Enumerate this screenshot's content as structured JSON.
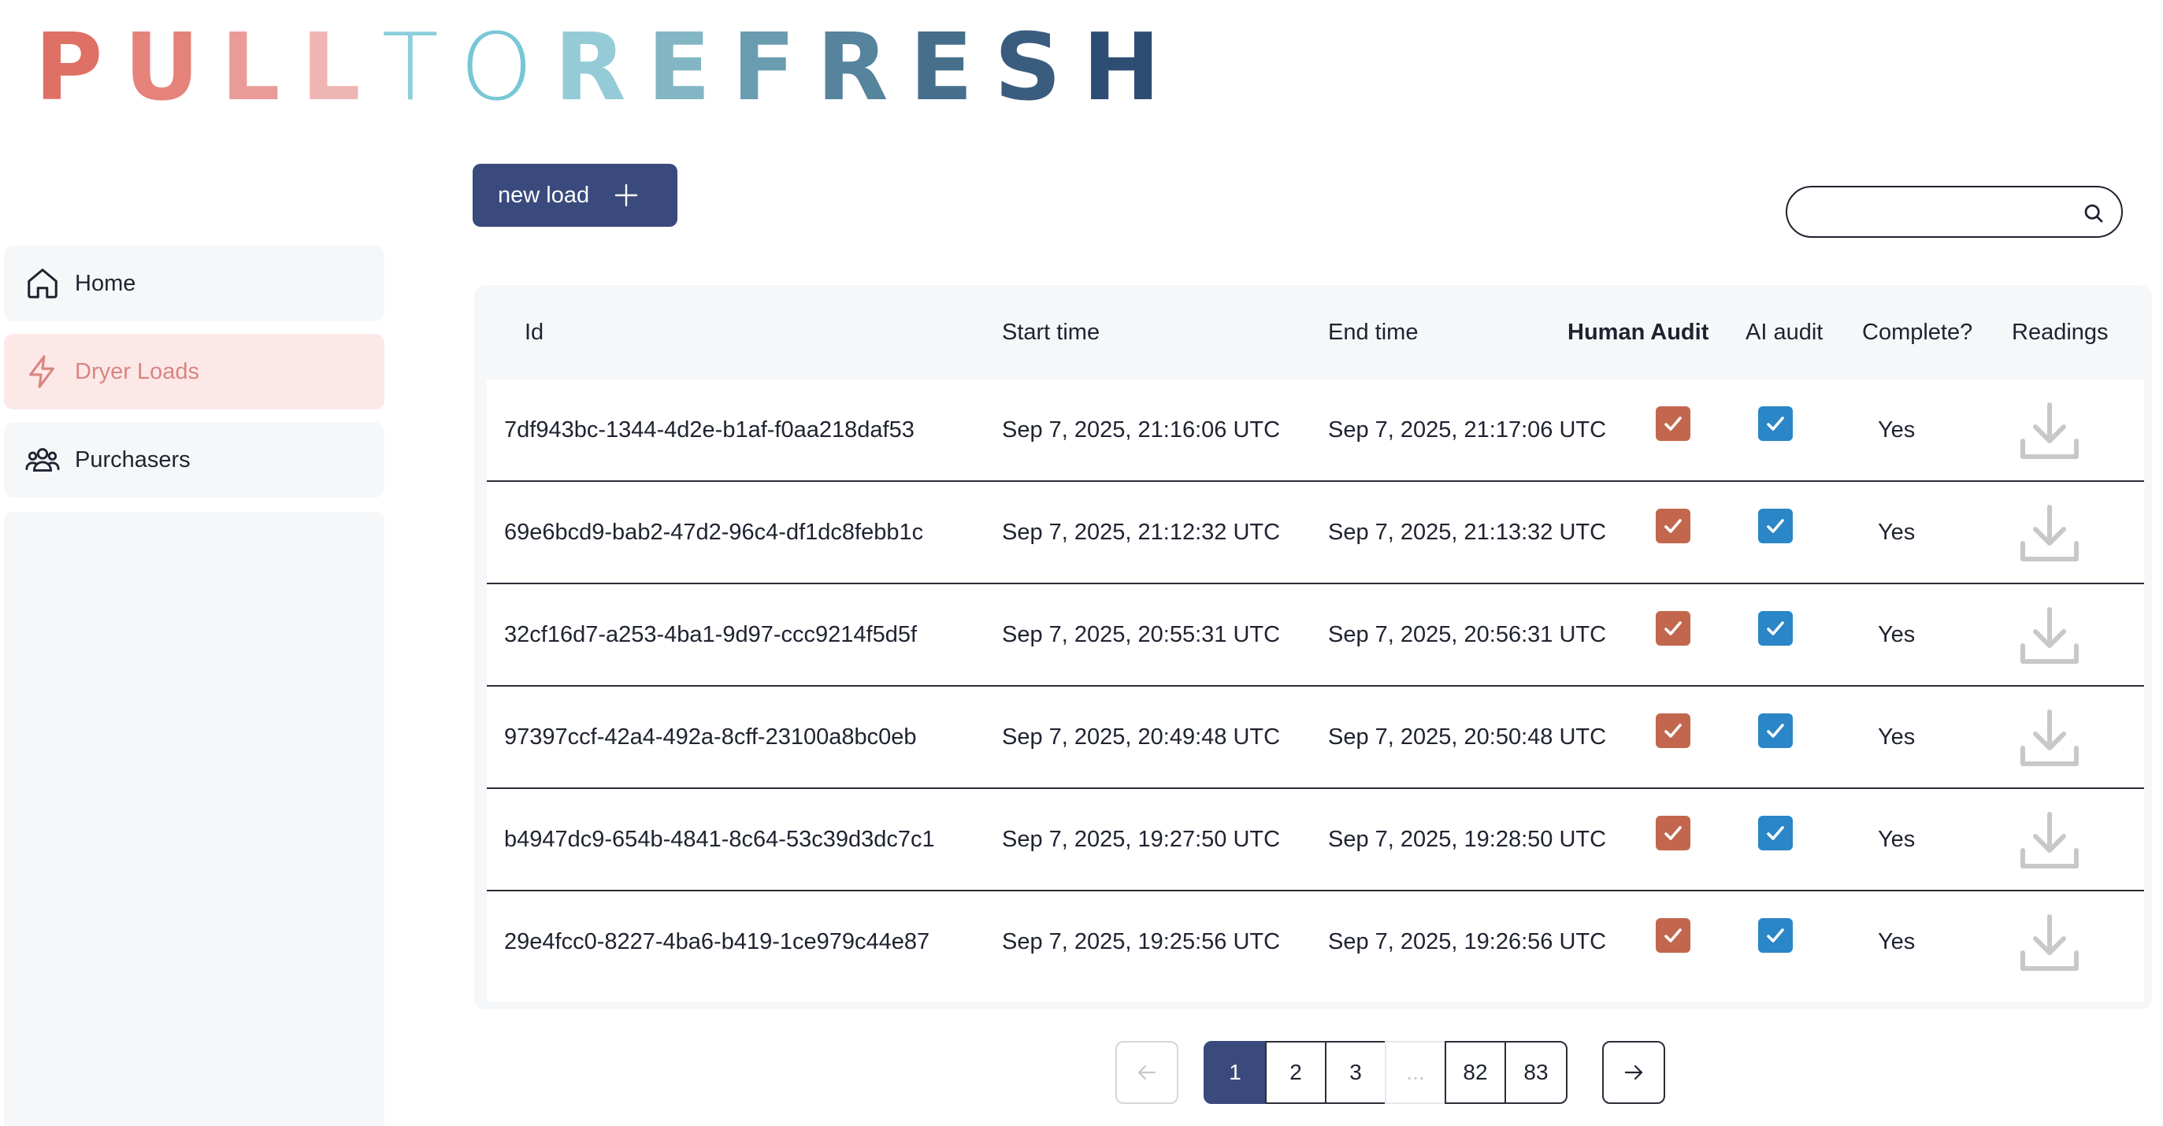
{
  "brand": {
    "letters": [
      "P",
      "U",
      "L",
      "L",
      "T",
      "O",
      "R",
      "E",
      "F",
      "R",
      "E",
      "S",
      "H"
    ],
    "colors": [
      "#df7066",
      "#e5837b",
      "#eb9b97",
      "#efb5b3",
      "#8ccfdb",
      "#79c6d6",
      "#94cbd7",
      "#83b6c4",
      "#6a9cb0",
      "#55849c",
      "#466f8c",
      "#3a5c7e",
      "#2d4e72"
    ]
  },
  "sidebar": {
    "items": [
      {
        "label": "Home",
        "icon": "home-icon"
      },
      {
        "label": "Dryer Loads",
        "icon": "lightning-icon"
      },
      {
        "label": "Purchasers",
        "icon": "users-icon"
      }
    ]
  },
  "toolbar": {
    "new_label": "new load"
  },
  "search": {
    "placeholder": "",
    "value": ""
  },
  "table": {
    "headers": [
      "Id",
      "Start time",
      "End time",
      "Human Audit",
      "AI audit",
      "Complete?",
      "Readings"
    ],
    "rows": [
      {
        "id": "7df943bc-1344-4d2e-b1af-f0aa218daf53",
        "start": "Sep 7, 2025, 21:16:06 UTC",
        "end": "Sep 7, 2025, 21:17:06 UTC",
        "complete": "Yes"
      },
      {
        "id": "69e6bcd9-bab2-47d2-96c4-df1dc8febb1c",
        "start": "Sep 7, 2025, 21:12:32 UTC",
        "end": "Sep 7, 2025, 21:13:32 UTC",
        "complete": "Yes"
      },
      {
        "id": "32cf16d7-a253-4ba1-9d97-ccc9214f5d5f",
        "start": "Sep 7, 2025, 20:55:31 UTC",
        "end": "Sep 7, 2025, 20:56:31 UTC",
        "complete": "Yes"
      },
      {
        "id": "97397ccf-42a4-492a-8cff-23100a8bc0eb",
        "start": "Sep 7, 2025, 20:49:48 UTC",
        "end": "Sep 7, 2025, 20:50:48 UTC",
        "complete": "Yes"
      },
      {
        "id": "b4947dc9-654b-4841-8c64-53c39d3dc7c1",
        "start": "Sep 7, 2025, 19:27:50 UTC",
        "end": "Sep 7, 2025, 19:28:50 UTC",
        "complete": "Yes"
      },
      {
        "id": "29e4fcc0-8227-4ba6-b419-1ce979c44e87",
        "start": "Sep 7, 2025, 19:25:56 UTC",
        "end": "Sep 7, 2025, 19:26:56 UTC",
        "complete": "Yes"
      }
    ]
  },
  "pagination": {
    "pages": [
      "1",
      "2",
      "3",
      "...",
      "82",
      "83"
    ],
    "current": "1"
  },
  "colors": {
    "accent": "#3a4a7c",
    "active_nav_bg": "#fde8e8",
    "active_nav_text": "#d98580",
    "human_audit": "#c2674d",
    "ai_audit": "#2a86c6"
  }
}
